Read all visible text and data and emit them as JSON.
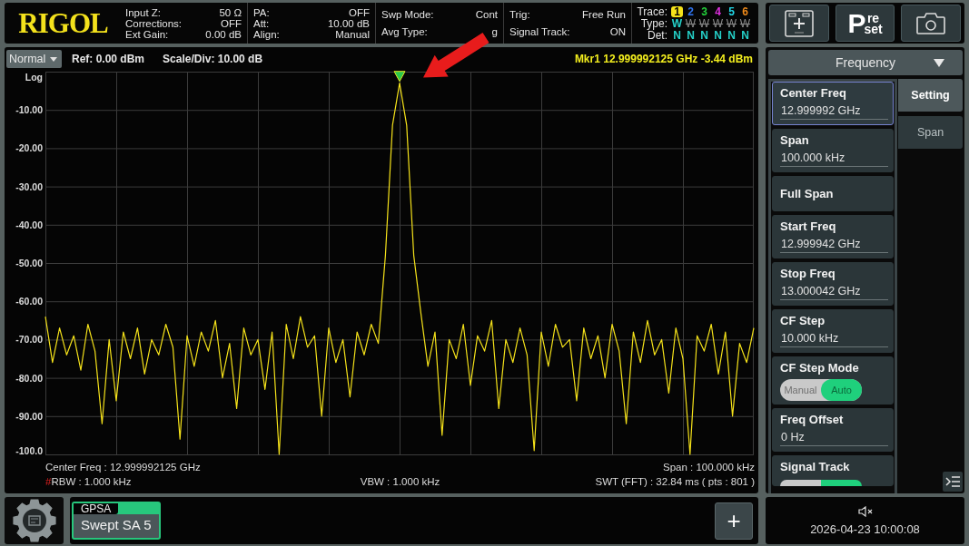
{
  "header": {
    "logo": "RIGOL",
    "info_groups": [
      {
        "rows": [
          {
            "label": "Input Z:",
            "value": "50 Ω"
          },
          {
            "label": "Corrections:",
            "value": "OFF"
          },
          {
            "label": "Ext Gain:",
            "value": "0.00 dB"
          }
        ]
      },
      {
        "rows": [
          {
            "label": "PA:",
            "value": "OFF"
          },
          {
            "label": "Att:",
            "value": "10.00 dB"
          },
          {
            "label": "Align:",
            "value": "Manual"
          }
        ]
      },
      {
        "rows": [
          {
            "label": "Swp Mode:",
            "value": "Cont"
          },
          {
            "label": "Avg Type:",
            "value": "g"
          }
        ]
      },
      {
        "rows": [
          {
            "label": "Trig:",
            "value": "Free Run"
          },
          {
            "label": "Signal Track:",
            "value": "ON"
          }
        ]
      }
    ],
    "traces": {
      "trace_label": "Trace:",
      "type_label": "Type:",
      "det_label": "Det:",
      "items": [
        {
          "number": "1",
          "color": "#f5e21a",
          "selected": true,
          "type": "W",
          "type_on": true,
          "det": "N"
        },
        {
          "number": "2",
          "color": "#2f74f0",
          "selected": false,
          "type": "W",
          "type_on": false,
          "det": "N"
        },
        {
          "number": "3",
          "color": "#24d23c",
          "selected": false,
          "type": "W",
          "type_on": false,
          "det": "N"
        },
        {
          "number": "4",
          "color": "#e030e0",
          "selected": false,
          "type": "W",
          "type_on": false,
          "det": "N"
        },
        {
          "number": "5",
          "color": "#22d8e8",
          "selected": false,
          "type": "W",
          "type_on": false,
          "det": "N"
        },
        {
          "number": "6",
          "color": "#f08a1a",
          "selected": false,
          "type": "W",
          "type_on": false,
          "det": "N"
        }
      ]
    }
  },
  "top_buttons": [
    {
      "kind": "user"
    },
    {
      "kind": "preset",
      "big": "P",
      "top": "re",
      "bottom": "set"
    },
    {
      "kind": "capture"
    }
  ],
  "toolbar": {
    "mode": "Normal",
    "ref": "Ref: 0.00 dBm",
    "scale": "Scale/Div: 10.00 dB",
    "marker": "Mkr1 12.999992125 GHz -3.44 dBm"
  },
  "plot": {
    "chart_data": {
      "type": "line",
      "grid": true,
      "ylim": [
        -100,
        0
      ],
      "yticks": [
        {
          "value": 0,
          "label": "Log"
        },
        {
          "value": -10,
          "label": "-10.00"
        },
        {
          "value": -20,
          "label": "-20.00"
        },
        {
          "value": -30,
          "label": "-30.00"
        },
        {
          "value": -40,
          "label": "-40.00"
        },
        {
          "value": -50,
          "label": "-50.00"
        },
        {
          "value": -60,
          "label": "-60.00"
        },
        {
          "value": -70,
          "label": "-70.00"
        },
        {
          "value": -80,
          "label": "-80.00"
        },
        {
          "value": -90,
          "label": "-90.00"
        },
        {
          "value": -100,
          "label": "-100.0"
        }
      ],
      "categories": [
        null,
        null,
        null,
        null,
        null,
        null,
        null,
        null,
        null,
        null,
        null,
        null,
        null,
        null,
        null,
        null,
        null,
        null,
        null,
        null,
        null,
        null,
        null,
        null,
        null,
        null,
        null,
        null,
        null,
        null,
        null,
        null,
        null,
        null,
        null,
        null,
        null,
        null,
        null,
        null,
        null,
        null,
        null,
        null,
        null,
        null,
        null,
        null,
        null,
        null,
        null,
        null,
        null,
        null,
        null,
        null,
        null,
        null,
        null,
        null,
        null,
        null,
        null,
        null,
        null,
        null,
        null,
        null,
        null,
        null,
        null,
        null,
        null,
        null,
        null,
        null,
        null,
        null,
        null,
        null,
        null,
        null,
        null,
        null,
        null,
        null,
        null,
        null,
        null,
        null,
        null,
        null,
        null,
        null,
        null,
        null,
        null,
        null,
        null,
        null,
        null
      ],
      "values": [
        -64,
        -76,
        -67,
        -74,
        -69,
        -78,
        -66,
        -73,
        -92,
        -70,
        -86,
        -68,
        -75,
        -67,
        -79,
        -70,
        -74,
        -66,
        -72,
        -96,
        -69,
        -77,
        -68,
        -73,
        -65,
        -80,
        -71,
        -88,
        -67,
        -74,
        -70,
        -83,
        -68,
        -100,
        -66,
        -75,
        -64,
        -72,
        -69,
        -90,
        -67,
        -76,
        -70,
        -85,
        -68,
        -74,
        -66,
        -71,
        -48,
        -14,
        -3,
        -14,
        -48,
        -63,
        -77,
        -68,
        -95,
        -70,
        -75,
        -66,
        -82,
        -69,
        -73,
        -65,
        -88,
        -70,
        -76,
        -67,
        -74,
        -99,
        -68,
        -77,
        -66,
        -72,
        -70,
        -86,
        -67,
        -75,
        -69,
        -80,
        -66,
        -73,
        -92,
        -68,
        -76,
        -65,
        -74,
        -70,
        -84,
        -67,
        -75,
        -100,
        -69,
        -73,
        -66,
        -79,
        -68,
        -90,
        -71,
        -76,
        -67
      ]
    }
  },
  "footer": {
    "center_freq": "Center Freq : 12.999992125 GHz",
    "span": "Span : 100.000 kHz",
    "rbw_flag": "#",
    "rbw": "RBW : 1.000 kHz",
    "vbw": "VBW : 1.000 kHz",
    "swt": "SWT (FFT) : 32.84 ms ( pts : 801 )"
  },
  "annotation": {
    "arrow": true
  },
  "menu": {
    "title": "Frequency",
    "items": [
      {
        "kind": "value",
        "label": "Center Freq",
        "value": "12.999992 GHz",
        "selected": true
      },
      {
        "kind": "value",
        "label": "Span",
        "value": "100.000 kHz",
        "selected": false
      },
      {
        "kind": "action",
        "label": "Full Span",
        "selected": false
      },
      {
        "kind": "value",
        "label": "Start Freq",
        "value": "12.999942 GHz",
        "selected": false
      },
      {
        "kind": "value",
        "label": "Stop Freq",
        "value": "13.000042 GHz",
        "selected": false
      },
      {
        "kind": "value",
        "label": "CF Step",
        "value": "10.000 kHz",
        "selected": false
      },
      {
        "kind": "toggle",
        "label": "CF Step Mode",
        "selected": false,
        "options": [
          {
            "label": "Manual",
            "selected": false
          },
          {
            "label": "Auto",
            "selected": true
          }
        ]
      },
      {
        "kind": "value",
        "label": "Freq Offset",
        "value": "0 Hz",
        "selected": false
      },
      {
        "kind": "switch",
        "label": "Signal Track",
        "selected": false,
        "on": true
      }
    ],
    "tabs": [
      {
        "label": "Setting",
        "selected": true
      },
      {
        "label": "Span",
        "selected": false
      }
    ]
  },
  "bottom_bar": {
    "tabs": [
      {
        "group": "GPSA",
        "label": "Swept SA 5",
        "selected": true
      }
    ],
    "add_label": "+"
  },
  "status": {
    "muted": true,
    "datetime": "2026-04-23 10:00:08"
  }
}
